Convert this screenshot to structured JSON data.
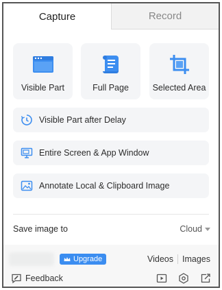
{
  "tabs": {
    "capture": "Capture",
    "record": "Record"
  },
  "cards": [
    {
      "label": "Visible Part",
      "icon": "browser-window-icon"
    },
    {
      "label": "Full Page",
      "icon": "scroll-page-icon"
    },
    {
      "label": "Selected Area",
      "icon": "crop-icon"
    }
  ],
  "rows": [
    {
      "label": "Visible Part after Delay",
      "icon": "timer-icon"
    },
    {
      "label": "Entire Screen & App Window",
      "icon": "monitor-icon"
    },
    {
      "label": "Annotate Local & Clipboard Image",
      "icon": "image-icon"
    }
  ],
  "save": {
    "label": "Save image to",
    "value": "Cloud"
  },
  "upgrade": "Upgrade",
  "links": {
    "videos": "Videos",
    "images": "Images"
  },
  "feedback": "Feedback",
  "colors": {
    "accent": "#3b8df0",
    "card_bg": "#f4f5f7"
  }
}
